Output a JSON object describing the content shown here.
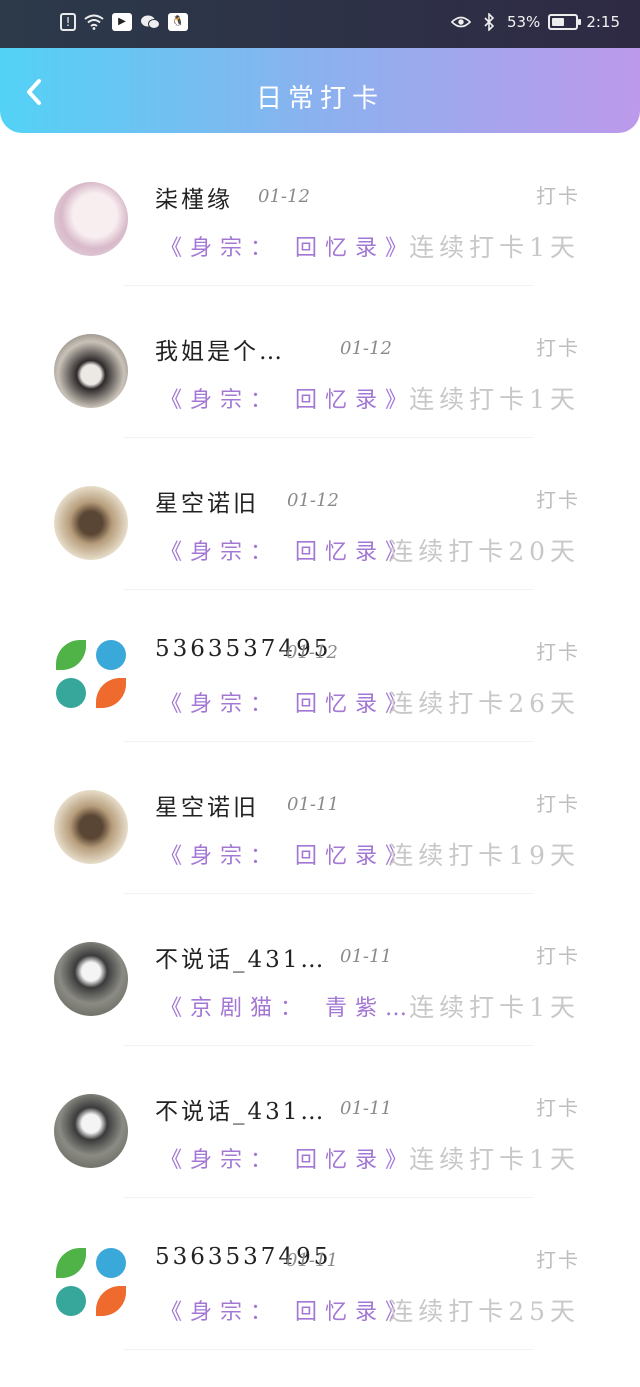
{
  "status_bar": {
    "battery_percent": "53%",
    "battery_level": 0.53,
    "time": "2:15",
    "left_icons": [
      "alert-icon",
      "wifi-icon",
      "video-app-icon",
      "wechat-icon",
      "qq-icon"
    ],
    "right_icons": [
      "eye-icon",
      "bluetooth-icon"
    ]
  },
  "header": {
    "title": "日常打卡",
    "back_icon": "chevron-left-icon"
  },
  "entries": [
    {
      "name": "柒槿缘",
      "date": "01-12",
      "action": "打卡",
      "book": "《身宗： 回忆录》",
      "streak": "连续打卡1天",
      "avatar": "anime-girl"
    },
    {
      "name": "我姐是个…",
      "date": "01-12",
      "action": "打卡",
      "book": "《身宗： 回忆录》",
      "streak": "连续打卡1天",
      "avatar": "masked-person"
    },
    {
      "name": "星空诺旧",
      "date": "01-12",
      "action": "打卡",
      "book": "《身宗： 回忆录》",
      "streak": "连续打卡20天",
      "avatar": "hogwarts-crest"
    },
    {
      "name": "5363537495",
      "date": "01-12",
      "action": "打卡",
      "book": "《身宗： 回忆录》",
      "streak": "连续打卡26天",
      "avatar": "four-elements"
    },
    {
      "name": "星空诺旧",
      "date": "01-11",
      "action": "打卡",
      "book": "《身宗： 回忆录》",
      "streak": "连续打卡19天",
      "avatar": "hogwarts-crest"
    },
    {
      "name": "不说话_431…",
      "date": "01-11",
      "action": "打卡",
      "book": "《京剧猫： 青紫…",
      "streak": "连续打卡1天",
      "avatar": "child-photo"
    },
    {
      "name": "不说话_431…",
      "date": "01-11",
      "action": "打卡",
      "book": "《身宗： 回忆录》",
      "streak": "连续打卡1天",
      "avatar": "child-photo"
    },
    {
      "name": "5363537495",
      "date": "01-11",
      "action": "打卡",
      "book": "《身宗： 回忆录》",
      "streak": "连续打卡25天",
      "avatar": "four-elements"
    }
  ]
}
